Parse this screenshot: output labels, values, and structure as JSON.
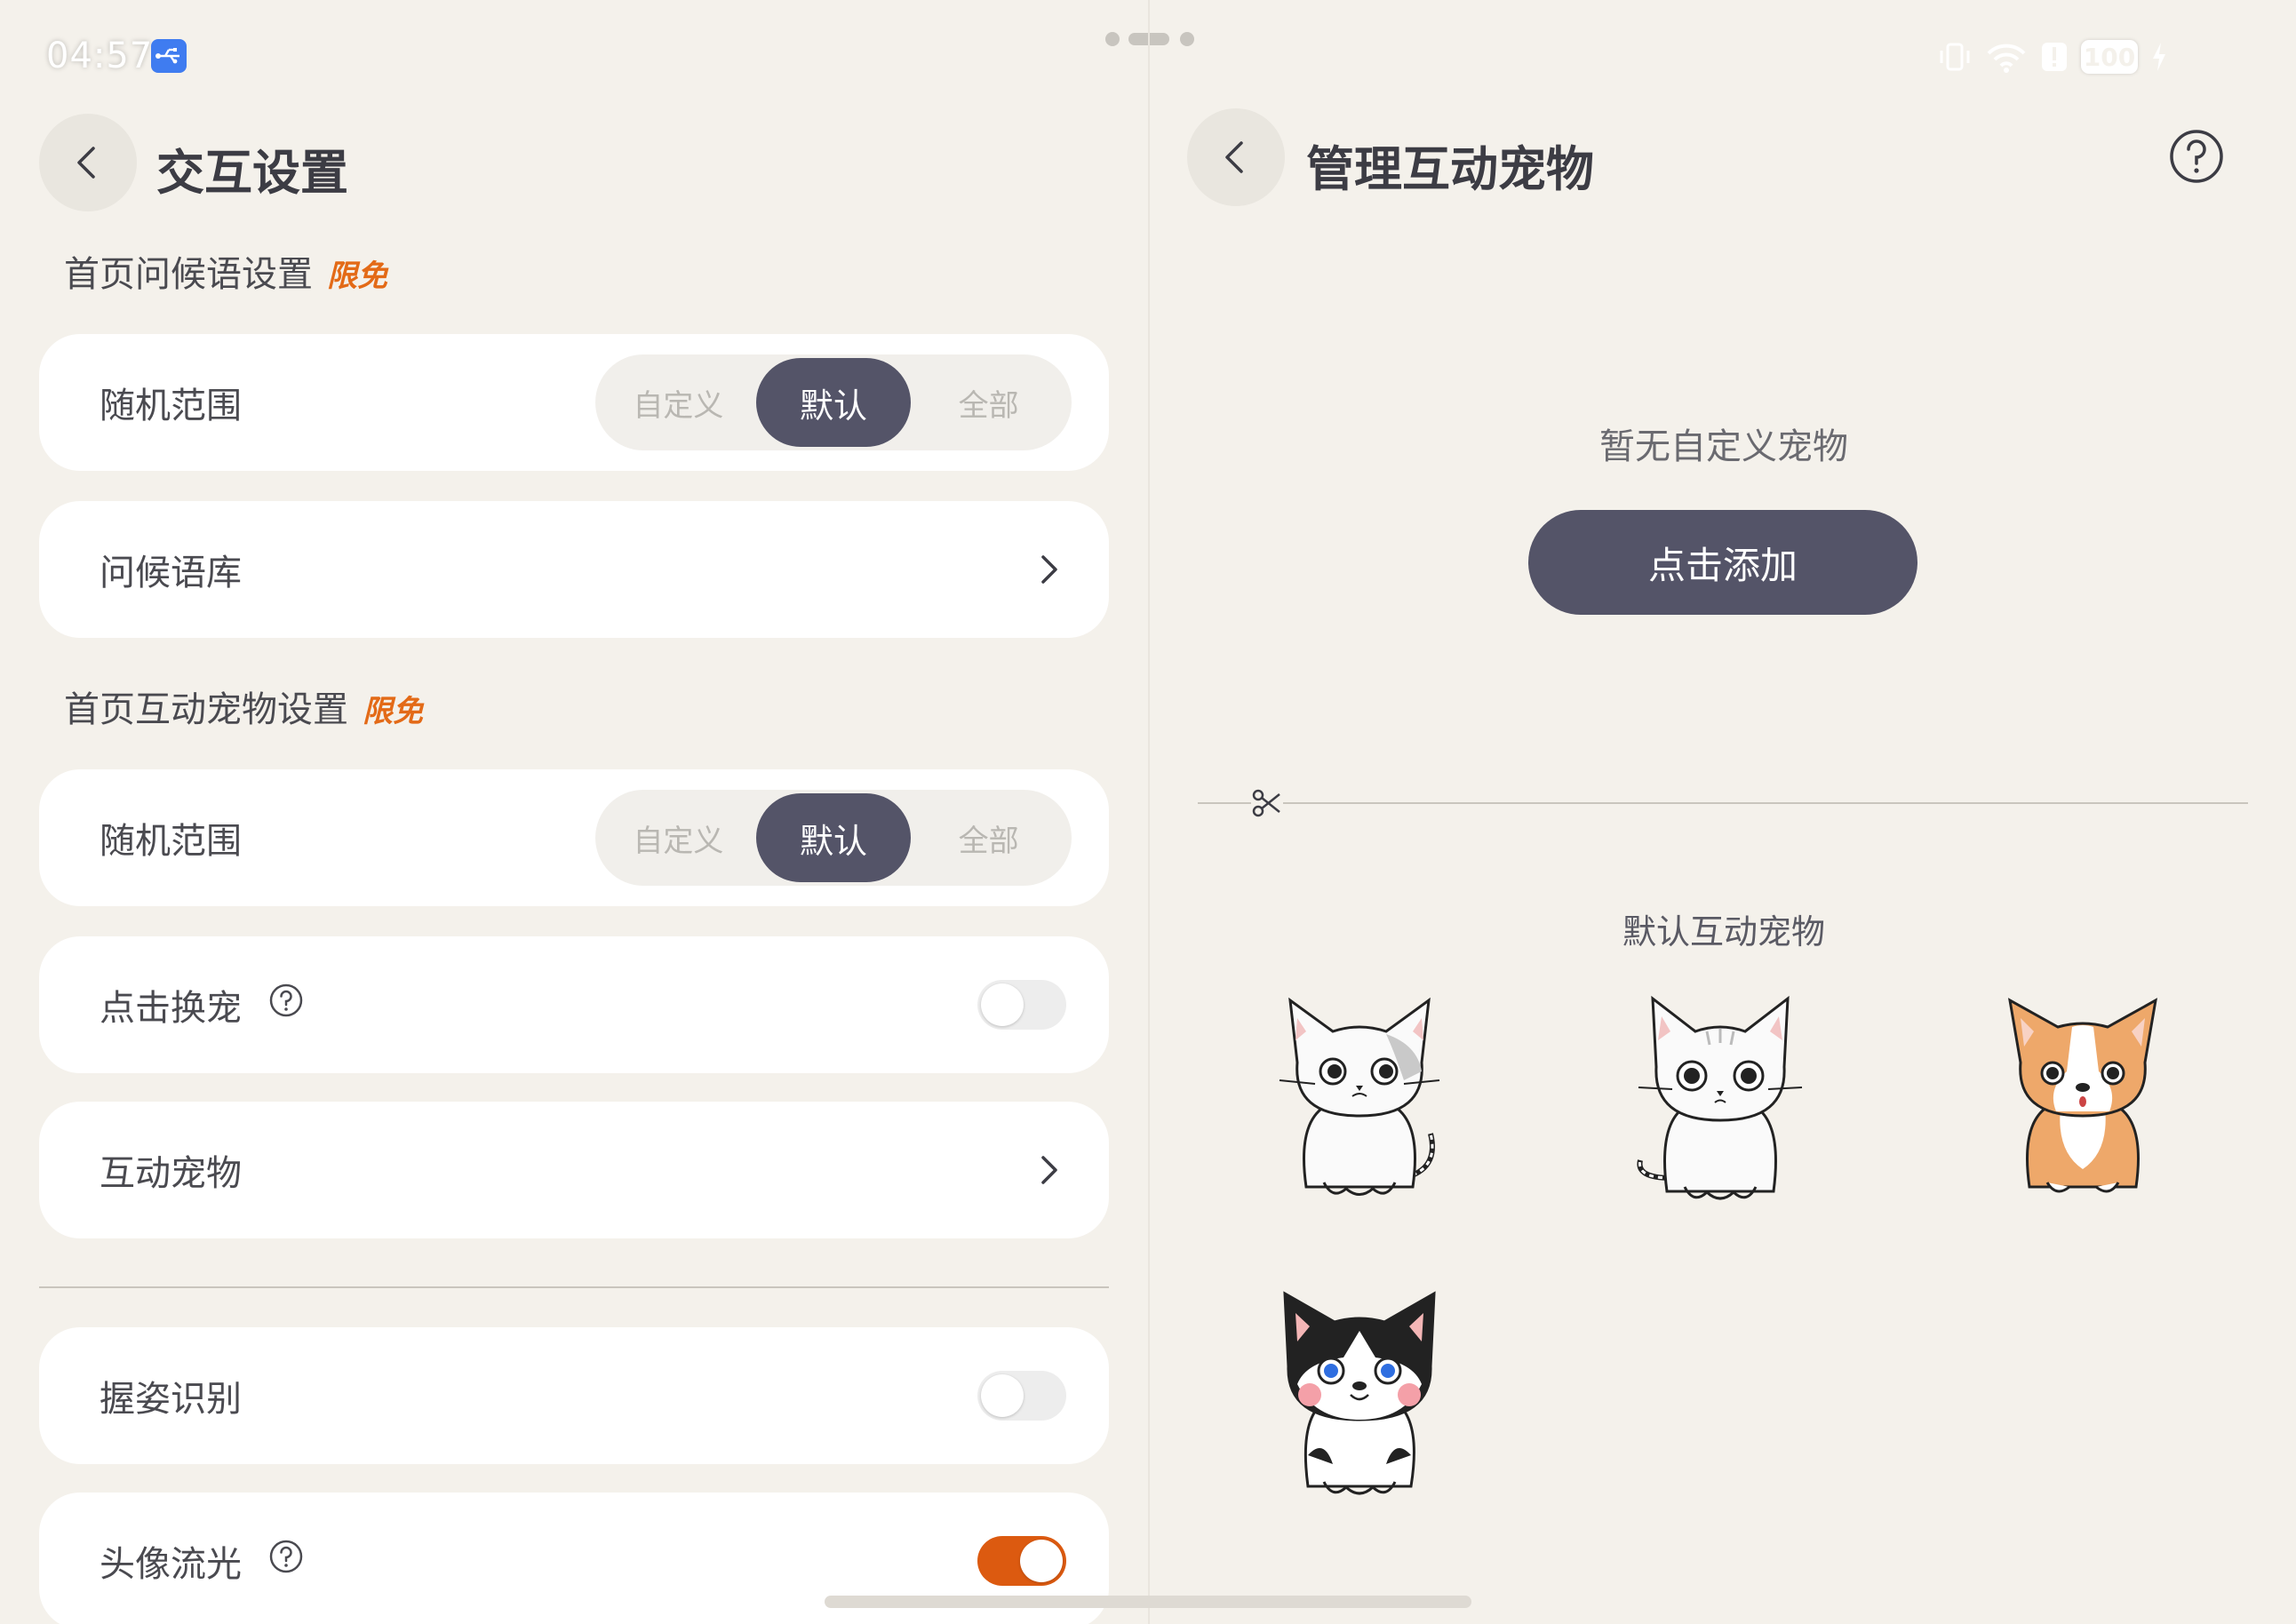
{
  "status_bar": {
    "time": "04:57",
    "usb_icon": "usb-icon",
    "battery": "100"
  },
  "left_pane": {
    "title": "交互设置",
    "greeting_section": {
      "title": "首页问候语设置",
      "tag": "限免",
      "random_range": {
        "label": "随机范围",
        "options": [
          "自定义",
          "默认",
          "全部"
        ],
        "selected": "默认"
      },
      "library": {
        "label": "问候语库"
      }
    },
    "pet_section": {
      "title": "首页互动宠物设置",
      "tag": "限免",
      "random_range": {
        "label": "随机范围",
        "options": [
          "自定义",
          "默认",
          "全部"
        ],
        "selected": "默认"
      },
      "tap_switch": {
        "label": "点击换宠",
        "on": false
      },
      "pets_link": {
        "label": "互动宠物"
      }
    },
    "grip_recognition": {
      "label": "握姿识别",
      "on": false
    },
    "avatar_glow": {
      "label": "头像流光",
      "on": true
    }
  },
  "right_pane": {
    "title": "管理互动宠物",
    "empty_text": "暂无自定义宠物",
    "add_button": "点击添加",
    "default_title": "默认互动宠物",
    "default_pets": [
      {
        "name": "tabby-cat",
        "kind": "cat"
      },
      {
        "name": "white-cat",
        "kind": "cat"
      },
      {
        "name": "corgi",
        "kind": "dog"
      },
      {
        "name": "husky",
        "kind": "dog"
      }
    ]
  },
  "colors": {
    "background": "#f4f1eb",
    "accent_dark": "#545468",
    "accent_orange": "#dc5a10",
    "tag_orange": "#e36a17"
  }
}
